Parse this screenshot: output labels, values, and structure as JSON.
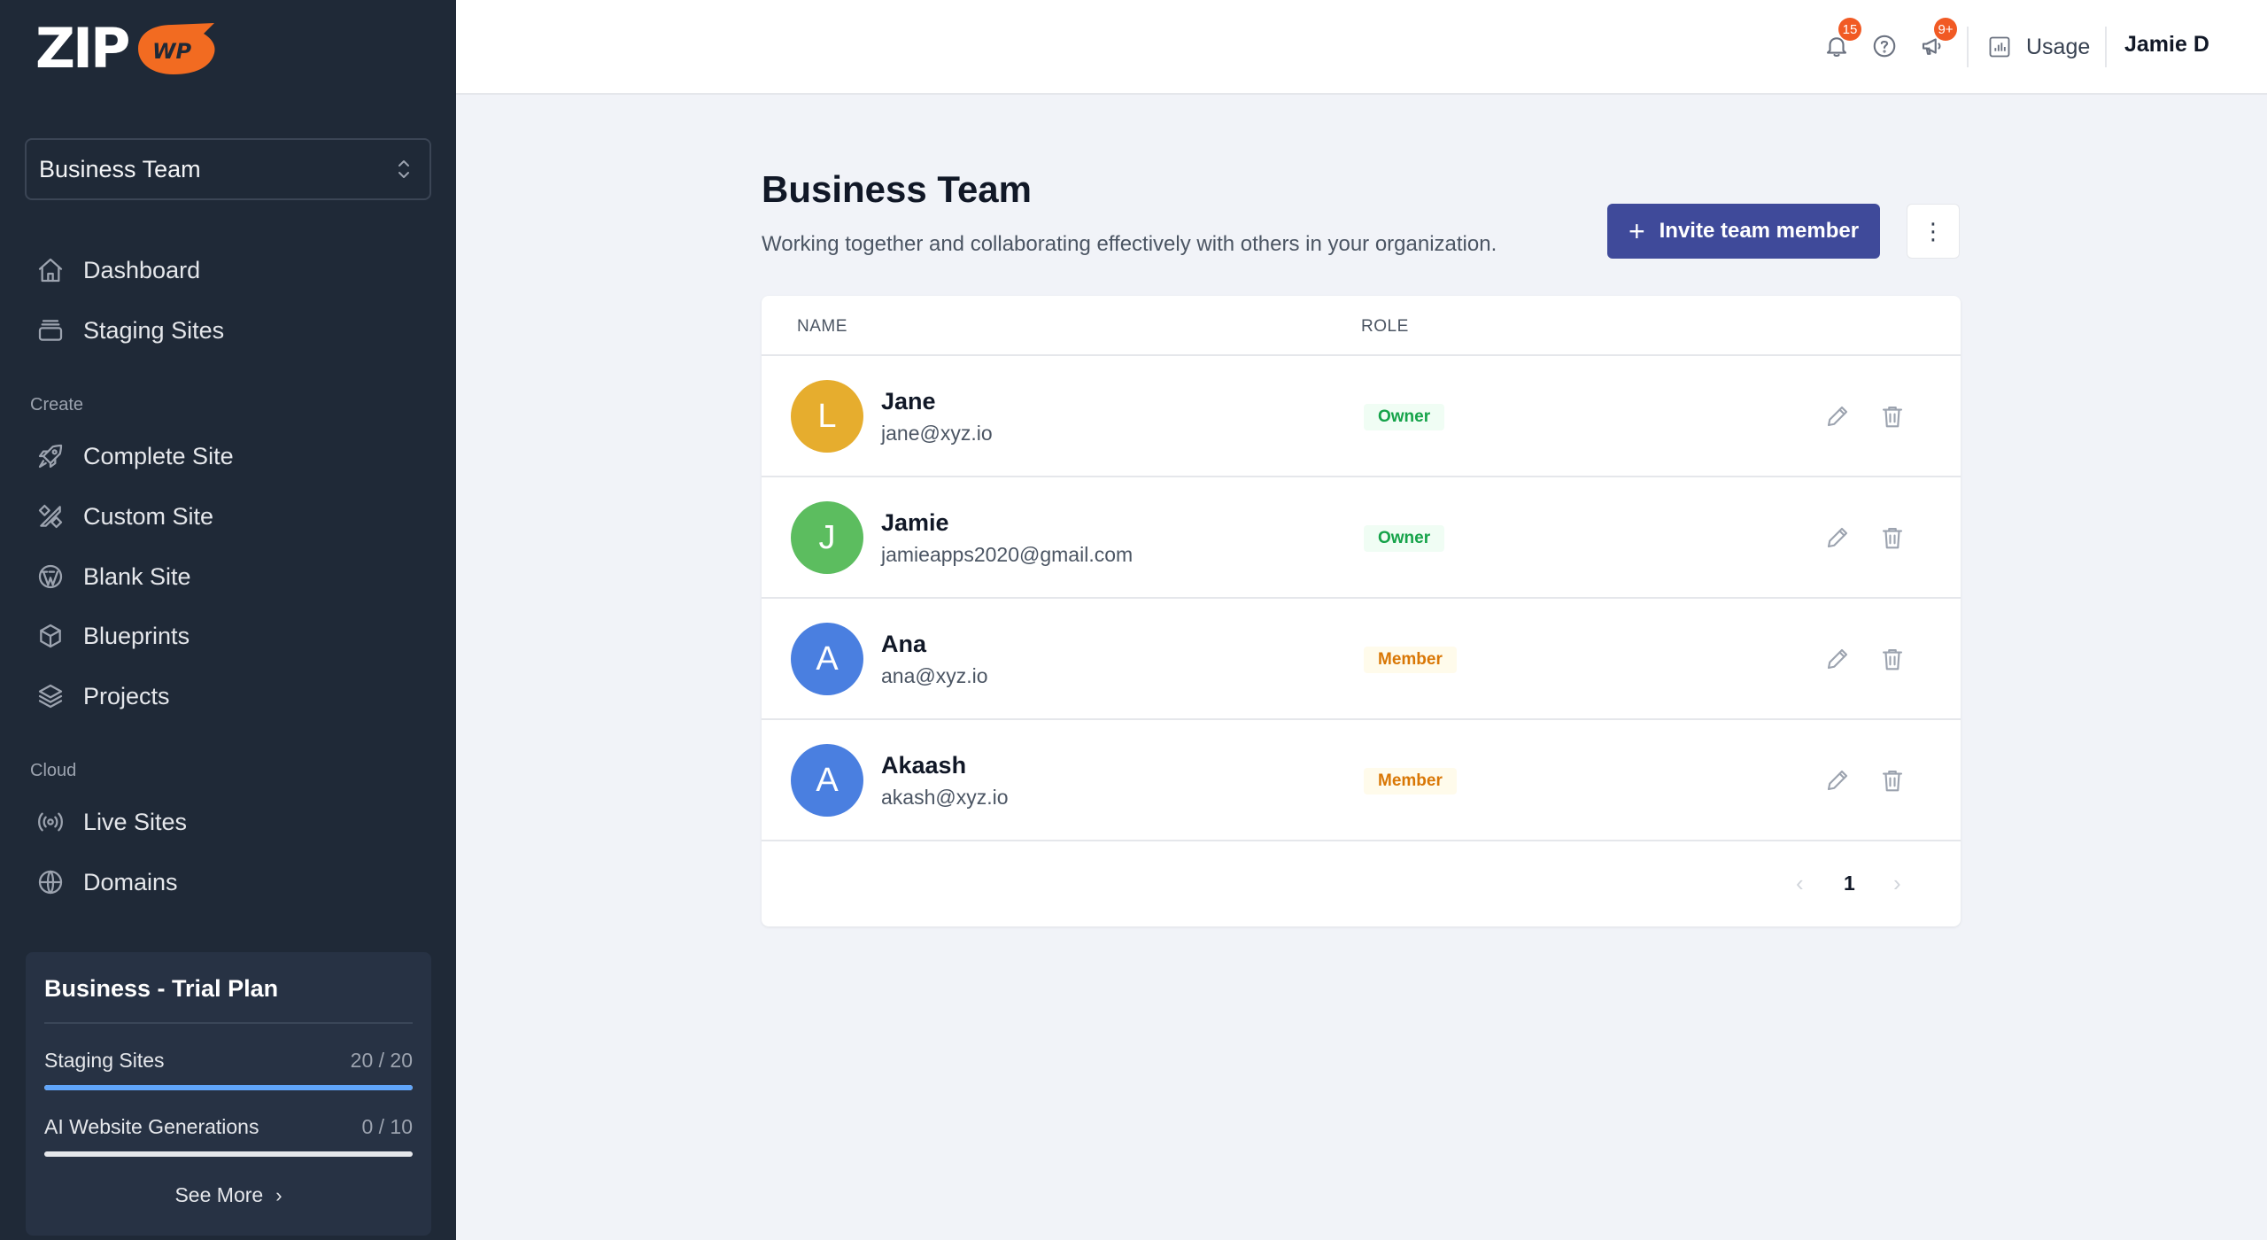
{
  "brand": {
    "logo_text": "ZIP",
    "logo_badge_text": "WP",
    "badge_color": "#f26b21"
  },
  "sidebar": {
    "team_selector": "Business Team",
    "main_items": [
      {
        "label": "Dashboard",
        "icon": "home-icon"
      },
      {
        "label": "Staging Sites",
        "icon": "staging-icon"
      }
    ],
    "create_heading": "Create",
    "create_items": [
      {
        "label": "Complete Site",
        "icon": "rocket-icon"
      },
      {
        "label": "Custom Site",
        "icon": "pencil-ruler-icon"
      },
      {
        "label": "Blank Site",
        "icon": "wordpress-icon"
      },
      {
        "label": "Blueprints",
        "icon": "cube-icon"
      },
      {
        "label": "Projects",
        "icon": "layers-icon"
      }
    ],
    "cloud_heading": "Cloud",
    "cloud_items": [
      {
        "label": "Live Sites",
        "icon": "broadcast-icon"
      },
      {
        "label": "Domains",
        "icon": "globe-icon"
      }
    ],
    "plan": {
      "title": "Business - Trial Plan",
      "usage": [
        {
          "label": "Staging Sites",
          "value": "20 / 20",
          "fraction": 1.0
        },
        {
          "label": "AI Website Generations",
          "value": "0 / 10",
          "fraction": 0.0
        }
      ],
      "see_more": "See More"
    }
  },
  "topbar": {
    "notifications_count": "15",
    "announcements_count": "9+",
    "usage_label": "Usage",
    "user_name": "Jamie D"
  },
  "page": {
    "title": "Business Team",
    "subtitle": "Working together and collaborating effectively with others in your organization.",
    "invite_label": "Invite team member",
    "more_label": "⋮"
  },
  "table": {
    "headers": {
      "name": "NAME",
      "role": "ROLE"
    },
    "rows": [
      {
        "initial": "L",
        "name": "Jane",
        "email": "jane@xyz.io",
        "role": "Owner",
        "avatar_color": "#e6ad2e"
      },
      {
        "initial": "J",
        "name": "Jamie",
        "email": "jamieapps2020@gmail.com",
        "role": "Owner",
        "avatar_color": "#5cbd5f"
      },
      {
        "initial": "A",
        "name": "Ana",
        "email": "ana@xyz.io",
        "role": "Member",
        "avatar_color": "#4a7fe0"
      },
      {
        "initial": "A",
        "name": "Akaash",
        "email": "akash@xyz.io",
        "role": "Member",
        "avatar_color": "#4a7fe0"
      }
    ],
    "pagination": {
      "prev": "‹",
      "current": "1",
      "next": "›"
    }
  },
  "colors": {
    "sidebar_bg": "#1f2937",
    "primary_button": "#3f4a9a",
    "owner_text": "#16a34a",
    "owner_bg": "#f0fdf4",
    "member_text": "#d97706",
    "member_bg": "#fffbeb",
    "progress": "#60a5fa"
  }
}
